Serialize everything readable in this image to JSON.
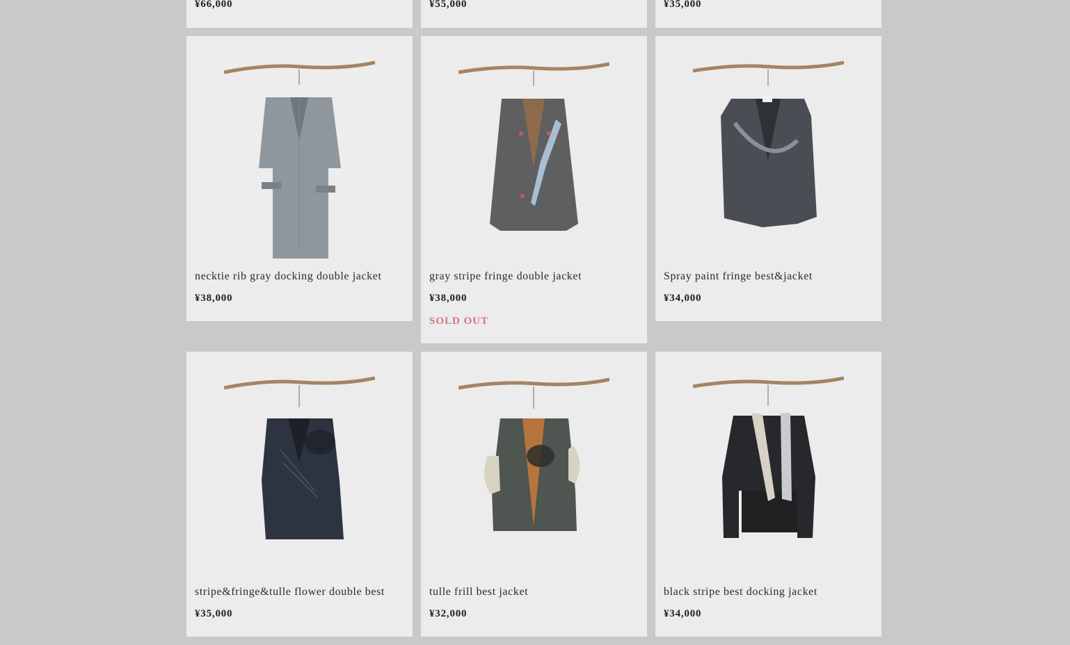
{
  "colors": {
    "background": "#c9c9c9",
    "card": "#ececec",
    "sold_out": "#d8727e"
  },
  "top_row": [
    {
      "price": "¥66,000"
    },
    {
      "price": "¥55,000"
    },
    {
      "price": "¥35,000"
    }
  ],
  "products": [
    {
      "title": "necktie rib gray docking double jacket",
      "price": "¥38,000",
      "sold_out": "",
      "garment": "gray short-sleeve double jacket"
    },
    {
      "title": "gray stripe fringe double jacket",
      "price": "¥38,000",
      "sold_out": "SOLD OUT",
      "garment": "gray stripe jacket with light blue fringe"
    },
    {
      "title": "Spray paint fringe best&jacket",
      "price": "¥34,000",
      "sold_out": "",
      "garment": "dark spray painted sleeveless jacket"
    },
    {
      "title": "stripe&fringe&tulle flower double best",
      "price": "¥35,000",
      "sold_out": "",
      "garment": "navy sleeveless vest with tulle flower"
    },
    {
      "title": "tulle frill best jacket",
      "price": "¥32,000",
      "sold_out": "",
      "garment": "green gray sleeveless jacket with tulle frill"
    },
    {
      "title": "black stripe best docking jacket",
      "price": "¥34,000",
      "sold_out": "",
      "garment": "black stripe jacket with neckties"
    }
  ]
}
